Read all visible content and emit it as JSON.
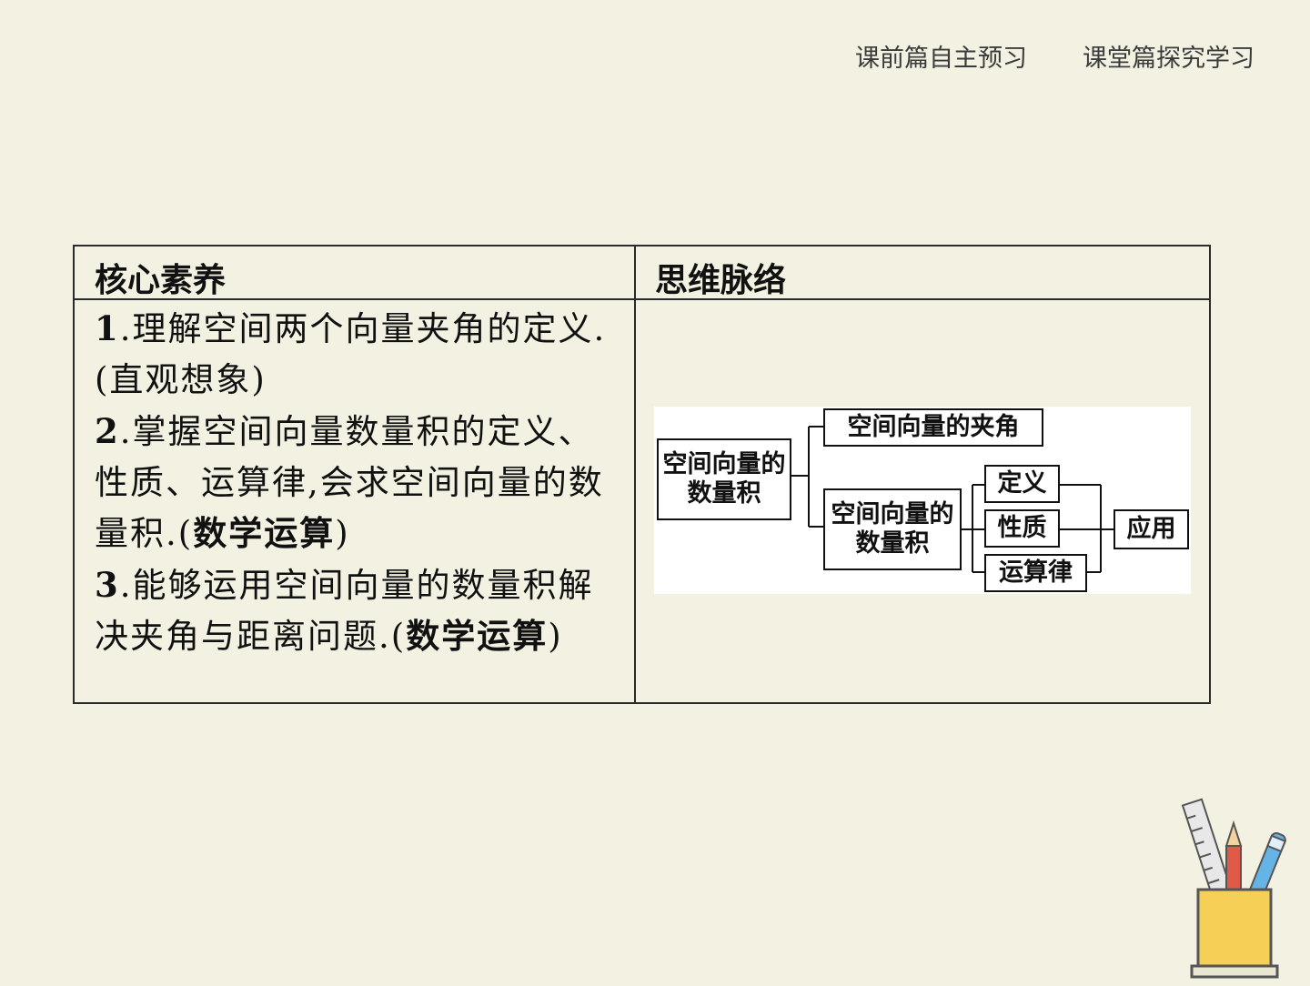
{
  "nav": {
    "tab_preclass": "课前篇自主预习",
    "tab_inclass": "课堂篇探究学习"
  },
  "table": {
    "header_left": "核心素养",
    "header_right": "思维脉络",
    "items": [
      {
        "num": "1",
        "text": ".理解空间两个向量夹角的定义.(直观想象)",
        "emphasis": "",
        "tail": ""
      },
      {
        "num": "2",
        "text": ".掌握空间向量数量积的定义、性质、运算律,会求空间向量的数量积.(",
        "emphasis": "数学运算",
        "tail": ")"
      },
      {
        "num": "3",
        "text": ".能够运用空间向量的数量积解决夹角与距离问题.(",
        "emphasis": "数学运算",
        "tail": ")"
      }
    ]
  },
  "mindmap": {
    "root": "空间向量的数量积",
    "branch_angle": "空间向量的夹角",
    "branch_product": "空间向量的数量积",
    "leaf_definition": "定义",
    "leaf_property": "性质",
    "leaf_law": "运算律",
    "result": "应用"
  },
  "decor": {
    "pencil_holder_icon": "pencil-cup-icon",
    "cup_color": "#f6cf57"
  }
}
